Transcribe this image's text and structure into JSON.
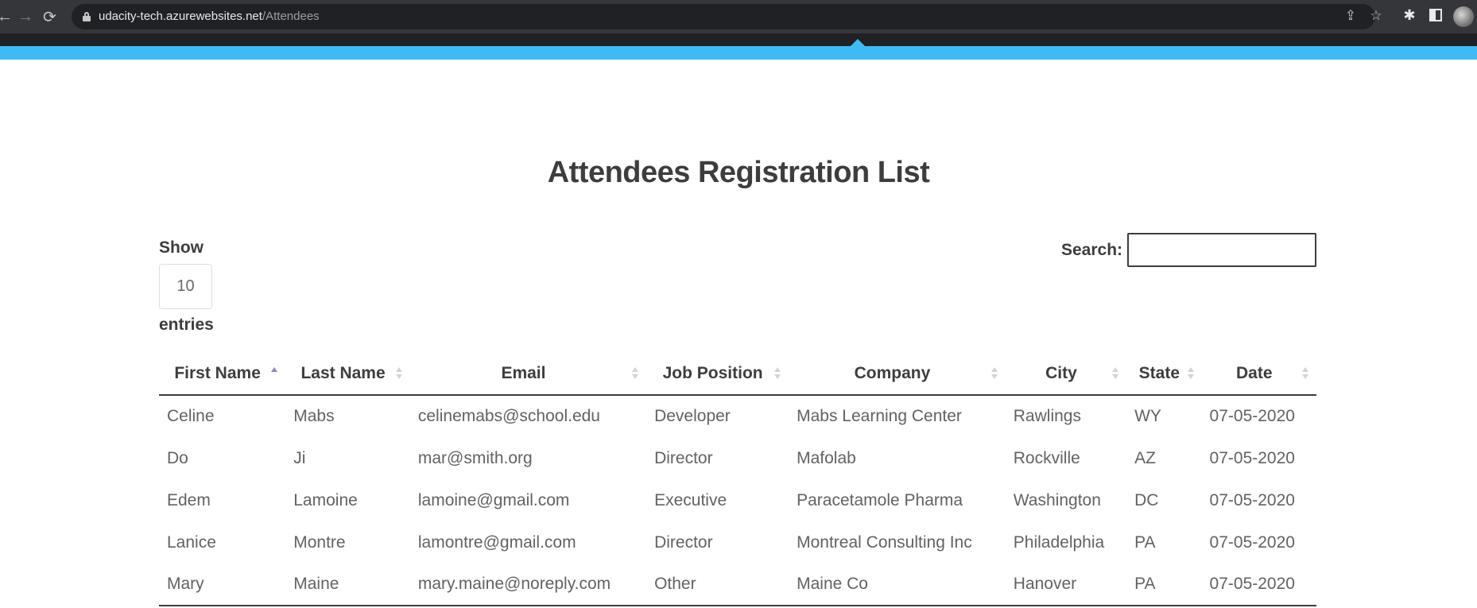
{
  "browser": {
    "url_host": "udacity-tech.azurewebsites.net",
    "url_path": "/Attendees",
    "back_glyph": "←",
    "forward_glyph": "→",
    "reload_glyph": "⟳",
    "share_glyph": "⇪",
    "star_glyph": "☆",
    "extensions_glyph": "✱"
  },
  "page": {
    "title": "Attendees Registration List",
    "accent_color": "#3fbbf4"
  },
  "controls": {
    "show_label": "Show",
    "length_value": "10",
    "entries_label": "entries",
    "search_label": "Search:",
    "search_value": ""
  },
  "table": {
    "columns": [
      {
        "label": "First Name",
        "sort": "asc"
      },
      {
        "label": "Last Name",
        "sort": "none"
      },
      {
        "label": "Email",
        "sort": "none"
      },
      {
        "label": "Job Position",
        "sort": "none"
      },
      {
        "label": "Company",
        "sort": "none"
      },
      {
        "label": "City",
        "sort": "none"
      },
      {
        "label": "State",
        "sort": "none"
      },
      {
        "label": "Date",
        "sort": "none"
      }
    ],
    "rows": [
      [
        "Celine",
        "Mabs",
        "celinemabs@school.edu",
        "Developer",
        "Mabs Learning Center",
        "Rawlings",
        "WY",
        "07-05-2020"
      ],
      [
        "Do",
        "Ji",
        "mar@smith.org",
        "Director",
        "Mafolab",
        "Rockville",
        "AZ",
        "07-05-2020"
      ],
      [
        "Edem",
        "Lamoine",
        "lamoine@gmail.com",
        "Executive",
        "Paracetamole Pharma",
        "Washington",
        "DC",
        "07-05-2020"
      ],
      [
        "Lanice",
        "Montre",
        "lamontre@gmail.com",
        "Director",
        "Montreal Consulting Inc",
        "Philadelphia",
        "PA",
        "07-05-2020"
      ],
      [
        "Mary",
        "Maine",
        "mary.maine@noreply.com",
        "Other",
        "Maine Co",
        "Hanover",
        "PA",
        "07-05-2020"
      ]
    ]
  }
}
